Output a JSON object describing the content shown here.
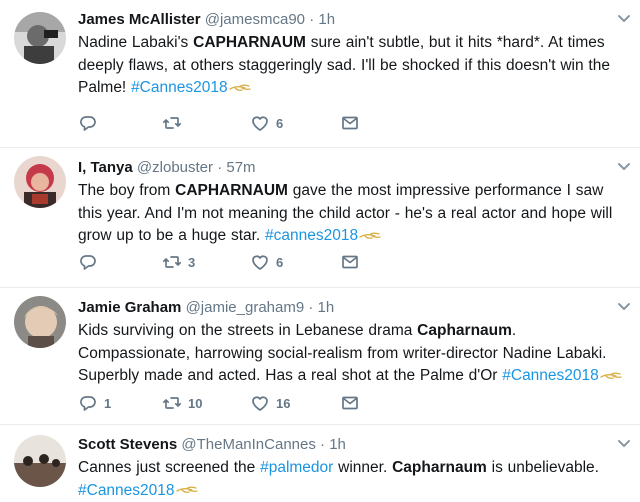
{
  "tweets": [
    {
      "name": "James McAllister",
      "handle": "@jamesmca90",
      "time": "1h",
      "text_parts": [
        {
          "t": "Nadine Labaki's ",
          "b": false
        },
        {
          "t": "CAPHARNAUM",
          "b": true
        },
        {
          "t": " sure ain't subtle, but it hits *hard*. At times deeply flaws, at others staggeringly sad. I'll be shocked if this doesn't win the Palme! ",
          "b": false
        }
      ],
      "hashtag": "#Cannes2018",
      "reply_count": "",
      "retweet_count": "",
      "like_count": "6"
    },
    {
      "name": "I, Tanya",
      "handle": "@zlobuster",
      "time": "57m",
      "text_parts": [
        {
          "t": "The boy from ",
          "b": false
        },
        {
          "t": "CAPHARNAUM",
          "b": true
        },
        {
          "t": " gave the most impressive performance I saw this year. And I'm not meaning the child actor - he's a real actor and hope will grow up to be a huge star. ",
          "b": false
        }
      ],
      "hashtag": "#cannes2018",
      "reply_count": "",
      "retweet_count": "3",
      "like_count": "6"
    },
    {
      "name": "Jamie Graham",
      "handle": "@jamie_graham9",
      "time": "1h",
      "text_parts": [
        {
          "t": "Kids surviving on the streets in Lebanese drama ",
          "b": false
        },
        {
          "t": "Capharnaum",
          "b": true
        },
        {
          "t": ". Compassionate, harrowing social-realism from writer-director Nadine Labaki. Superbly made and acted. Has a real shot at the Palme d'Or ",
          "b": false
        }
      ],
      "hashtag": "#Cannes2018",
      "reply_count": "1",
      "retweet_count": "10",
      "like_count": "16"
    },
    {
      "name": "Scott Stevens",
      "handle": "@TheManInCannes",
      "time": "1h",
      "text_parts": [
        {
          "t": "Cannes just screened the ",
          "b": false
        },
        {
          "t": "#palmedor",
          "b": false,
          "h": true
        },
        {
          "t": " winner.  ",
          "b": false
        },
        {
          "t": "Capharnaum",
          "b": true
        },
        {
          "t": " is unbelievable.",
          "b": false
        }
      ],
      "hashtag": "#Cannes2018",
      "reply_count": "",
      "retweet_count": "",
      "like_count": ""
    }
  ],
  "separator": "·",
  "icons": {
    "reply": "reply-icon",
    "retweet": "retweet-icon",
    "like": "heart-icon",
    "dm": "envelope-icon",
    "caret": "chevron-down-icon"
  },
  "colors": {
    "hashtag": "#1b95e0",
    "muted": "#657786",
    "divider": "#e6ecf0"
  }
}
